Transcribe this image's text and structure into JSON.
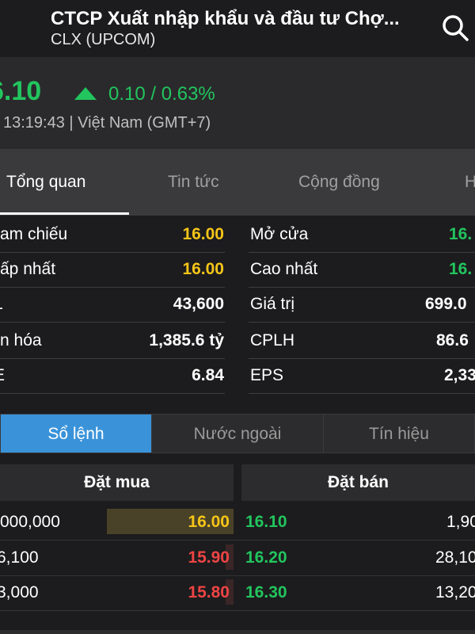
{
  "header": {
    "company": "CTCP Xuất nhập khẩu và đầu tư Chợ...",
    "ticker": "CLX (UPCOM)"
  },
  "quote": {
    "price": "6.10",
    "change": "0.10 / 0.63%",
    "time": "13:19:43 | Việt Nam (GMT+7)"
  },
  "tabs": [
    {
      "label": "Tổng quan"
    },
    {
      "label": "Tin tức"
    },
    {
      "label": "Cộng đồng"
    },
    {
      "label": "H"
    }
  ],
  "stats": {
    "left": [
      {
        "label": "am chiếu",
        "value": "16.00",
        "color": "#f5c518"
      },
      {
        "label": "ấp nhất",
        "value": "16.00",
        "color": "#f5c518"
      },
      {
        "label": "L",
        "value": "43,600",
        "color": "#ffffff"
      },
      {
        "label": "n hóa",
        "value": "1,385.6 tỷ",
        "color": "#ffffff"
      },
      {
        "label": "E",
        "value": "6.84",
        "color": "#ffffff"
      }
    ],
    "right": [
      {
        "label": "Mở cửa",
        "value": "16.",
        "color": "#22c55e"
      },
      {
        "label": "Cao nhất",
        "value": "16.",
        "color": "#22c55e"
      },
      {
        "label": "Giá trị",
        "value": "699.0",
        "color": "#ffffff"
      },
      {
        "label": "CPLH",
        "value": "86.6",
        "color": "#ffffff"
      },
      {
        "label": "EPS",
        "value": "2,33",
        "color": "#ffffff"
      }
    ]
  },
  "orderbook": {
    "tabs": [
      {
        "label": "Sổ lệnh"
      },
      {
        "label": "Nước ngoài"
      },
      {
        "label": "Tín hiệu"
      }
    ],
    "bid_header": "Đặt mua",
    "ask_header": "Đặt bán",
    "rows": [
      {
        "bid_qty": "000,000",
        "bid_price": "16.00",
        "bid_color": "#f5c518",
        "ask_price": "16.10",
        "ask_qty": "1,90"
      },
      {
        "bid_qty": "6,100",
        "bid_price": "15.90",
        "bid_color": "#ef4444",
        "ask_price": "16.20",
        "ask_qty": "28,10"
      },
      {
        "bid_qty": "3,000",
        "bid_price": "15.80",
        "bid_color": "#ef4444",
        "ask_price": "16.30",
        "ask_qty": "13,20"
      }
    ]
  },
  "colors": {
    "up": "#22c55e",
    "reference": "#f5c518",
    "down": "#ef4444",
    "accent": "#3a93d9"
  },
  "icons": {
    "search": "search-icon",
    "trend": "triangle-up-icon"
  }
}
